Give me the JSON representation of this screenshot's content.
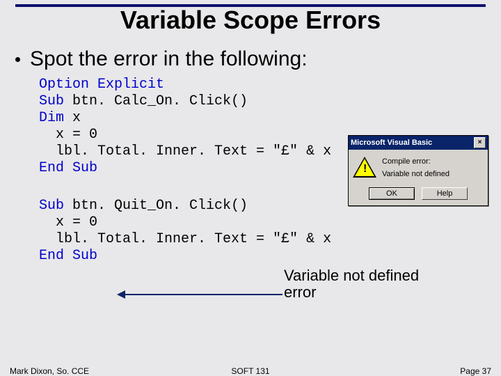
{
  "title": "Variable Scope Errors",
  "bullet": "Spot the error in the following:",
  "code1": {
    "l1a": "Option Explicit",
    "l2a": "Sub",
    "l2b": " btn. Calc_On. Click()",
    "l3a": "Dim",
    "l3b": " x",
    "l4": "  x = 0",
    "l5": "  lbl. Total. Inner. Text = \"£\" & x",
    "l6": "End Sub"
  },
  "code2": {
    "l1a": "Sub",
    "l1b": " btn. Quit_On. Click()",
    "l2": "  x = 0",
    "l3": "  lbl. Total. Inner. Text = \"£\" & x",
    "l4": "End Sub"
  },
  "dialog": {
    "title": "Microsoft Visual Basic",
    "msg1": "Compile error:",
    "msg2": "Variable not defined",
    "ok": "OK",
    "help": "Help",
    "close": "×"
  },
  "annotation": {
    "line1": "Variable not defined",
    "line2": " error"
  },
  "footer": {
    "left": "Mark Dixon, So. CCE",
    "center": "SOFT 131",
    "right": "Page 37"
  }
}
